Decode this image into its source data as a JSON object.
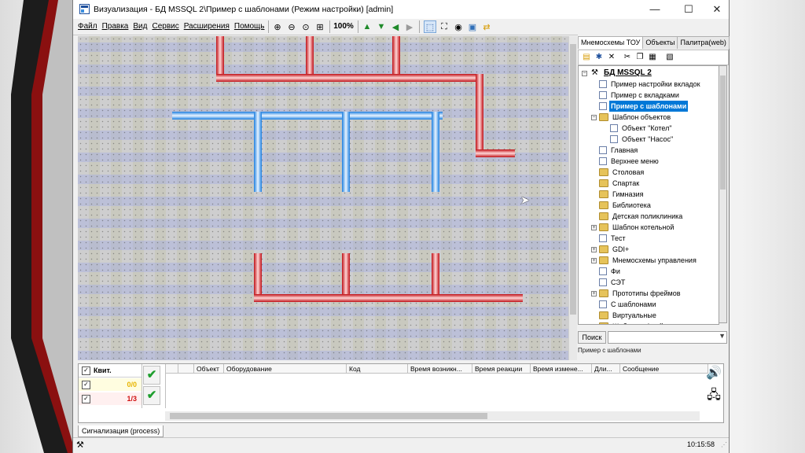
{
  "window": {
    "title": "Визуализация - БД MSSQL 2\\Пример с шаблонами (Режим настройки) [admin]",
    "minimize_glyph": "—",
    "maximize_glyph": "☐",
    "close_glyph": "✕"
  },
  "menu": {
    "items": [
      "Файл",
      "Правка",
      "Вид",
      "Сервис",
      "Расширения",
      "Помощь"
    ]
  },
  "toolbar": {
    "zoom_level": "100%",
    "icons": [
      "zoom-in-icon",
      "zoom-out-icon",
      "zoom-reset-icon",
      "zoom-fit-icon",
      "arrow-up-icon",
      "arrow-down-icon",
      "arrow-left-icon",
      "arrow-right-icon",
      "select-mode-icon",
      "frame-icon",
      "eye-icon",
      "save-icon",
      "refresh-icon"
    ]
  },
  "pipes": {
    "red_color": "#e0262d",
    "blue_color": "#2b8fe6"
  },
  "right_panel": {
    "tabs": [
      "Мнемосхемы ТОУ",
      "Объекты",
      "Палитра(web)"
    ],
    "active_tab": 0,
    "tree": [
      {
        "label": "БД MSSQL 2",
        "level": 0,
        "icon": "tools",
        "root": true,
        "expander": "−"
      },
      {
        "label": "Пример настройки вкладок",
        "level": 1,
        "icon": "page"
      },
      {
        "label": "Пример с вкладками",
        "level": 1,
        "icon": "page"
      },
      {
        "label": "Пример с шаблонами",
        "level": 1,
        "icon": "page",
        "selected": true
      },
      {
        "label": "Шаблон объектов",
        "level": 1,
        "icon": "folder",
        "expander": "−"
      },
      {
        "label": "Объект \"Котел\"",
        "level": 2,
        "icon": "page"
      },
      {
        "label": "Объект \"Насос\"",
        "level": 2,
        "icon": "page"
      },
      {
        "label": "Главная",
        "level": 1,
        "icon": "page"
      },
      {
        "label": "Верхнее меню",
        "level": 1,
        "icon": "page"
      },
      {
        "label": "Столовая",
        "level": 1,
        "icon": "folder"
      },
      {
        "label": "Спартак",
        "level": 1,
        "icon": "folder"
      },
      {
        "label": "Гимназия",
        "level": 1,
        "icon": "folder"
      },
      {
        "label": "Библиотека",
        "level": 1,
        "icon": "folder"
      },
      {
        "label": "Детская поликлиника",
        "level": 1,
        "icon": "folder"
      },
      {
        "label": "Шаблон котельной",
        "level": 1,
        "icon": "folder",
        "expander": "+"
      },
      {
        "label": "Тест",
        "level": 1,
        "icon": "page"
      },
      {
        "label": "GDI+",
        "level": 1,
        "icon": "folder",
        "expander": "+"
      },
      {
        "label": "Мнемосхемы управления",
        "level": 1,
        "icon": "folder",
        "expander": "+"
      },
      {
        "label": "Фи",
        "level": 1,
        "icon": "page"
      },
      {
        "label": "СЭТ",
        "level": 1,
        "icon": "page"
      },
      {
        "label": "Прототипы фреймов",
        "level": 1,
        "icon": "folder",
        "expander": "+"
      },
      {
        "label": "С шаблонами",
        "level": 1,
        "icon": "page"
      },
      {
        "label": "Виртуальные",
        "level": 1,
        "icon": "folder"
      },
      {
        "label": "Шаблоны фреймов",
        "level": 1,
        "icon": "folder",
        "expander": "+"
      }
    ],
    "search_label": "Поиск",
    "search_value": "",
    "status_path": "Пример с шаблонами"
  },
  "alarms": {
    "ack_label": "Квит.",
    "counts": [
      {
        "value": "0/0",
        "color": "#e8b400"
      },
      {
        "value": "1/3",
        "color": "#d01010"
      }
    ],
    "columns": [
      "",
      "Объект",
      "Оборудование",
      "Код",
      "Время возникн...",
      "Время реакции",
      "Время измене...",
      "Дли...",
      "Сообщение"
    ],
    "tab_label": "Сигнализация (process)"
  },
  "statusbar": {
    "clock": "10:15:58"
  }
}
